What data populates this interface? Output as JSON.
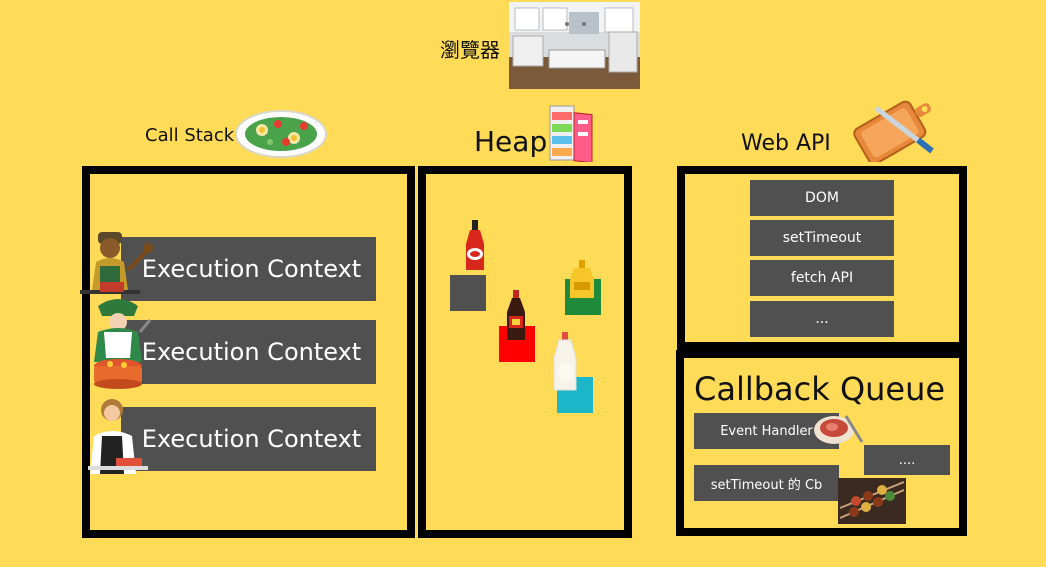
{
  "browser": {
    "label": "瀏覽器",
    "icon": "kitchen-photo"
  },
  "call_stack": {
    "title": "Call Stack",
    "icon": "salad-bowl-icon",
    "frames": [
      "Execution Context",
      "Execution Context",
      "Execution Context"
    ],
    "chef_icons": [
      "chef-cooking-icon",
      "chef-pot-icon",
      "chef-cutting-icon"
    ]
  },
  "heap": {
    "title": "Heap",
    "icon": "fridge-icon",
    "items": [
      "ketchup-icon",
      "mustard-icon",
      "soy-sauce-icon",
      "mayonnaise-icon"
    ],
    "colors": {
      "gray": "#505050",
      "green": "#1E8A3A",
      "red": "#FF0000",
      "teal": "#1CB6C8"
    }
  },
  "web_api": {
    "title": "Web API",
    "icon": "cutting-board-icon",
    "items": [
      "DOM",
      "setTimeout",
      "fetch API",
      "..."
    ]
  },
  "callback_queue": {
    "title": "Callback Queue",
    "items": [
      "Event Handler",
      "....",
      "setTimeout 的 Cb"
    ],
    "icons": [
      "steak-icon",
      "skewers-photo"
    ]
  },
  "colors": {
    "background": "#FFDB58",
    "box": "#505050",
    "border": "#000000"
  }
}
